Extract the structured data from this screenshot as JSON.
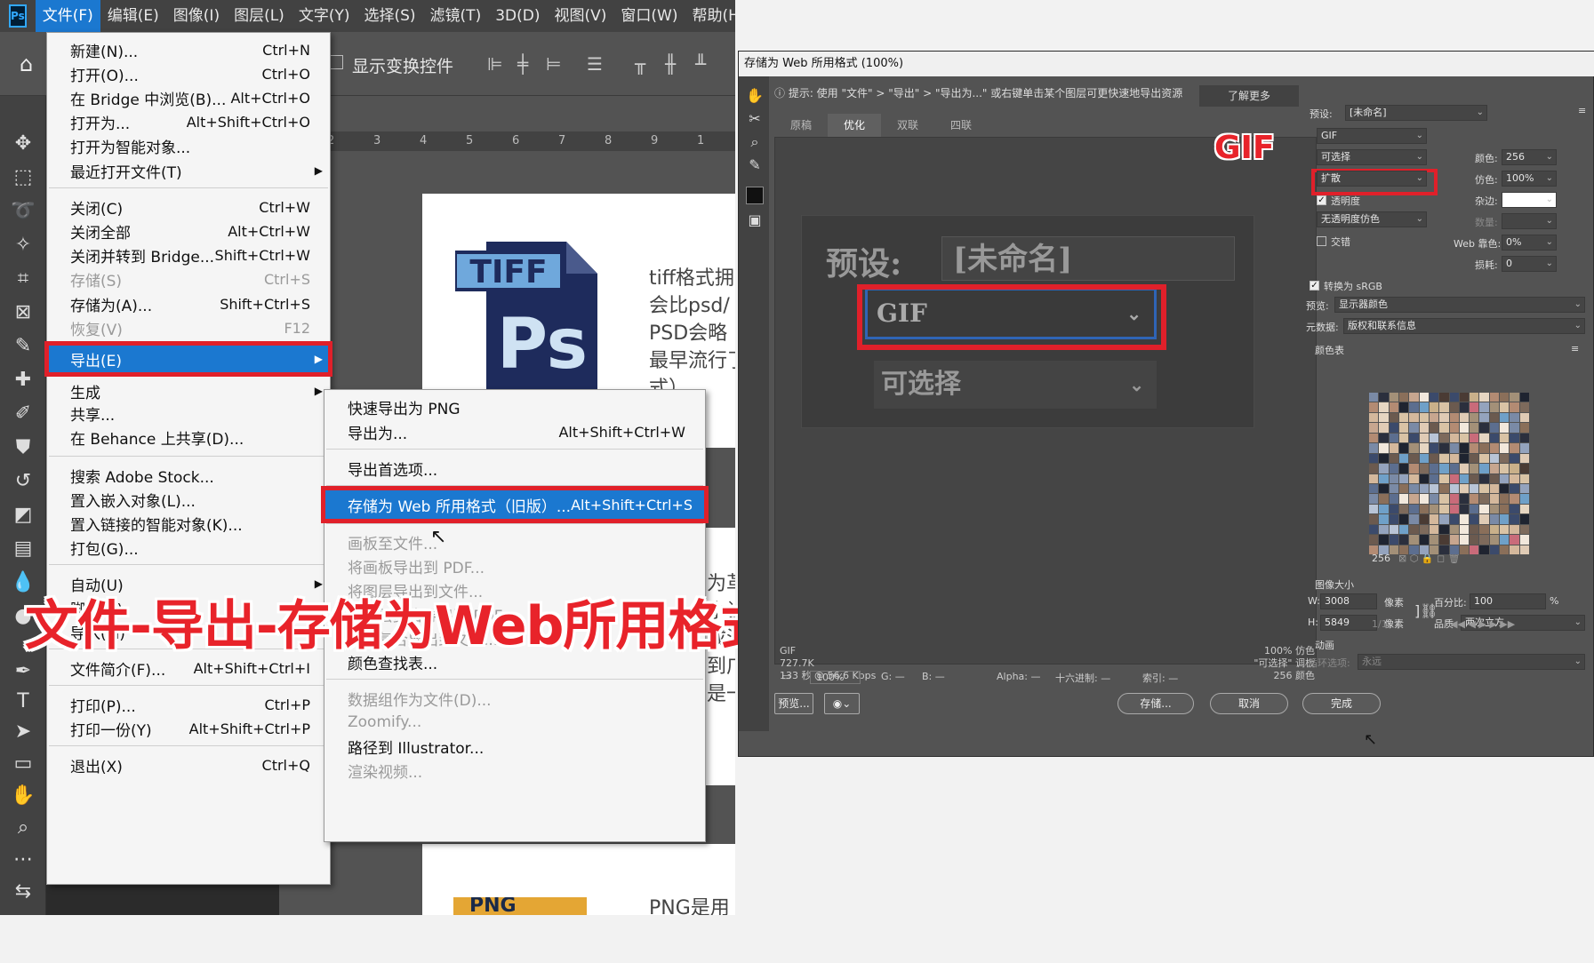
{
  "ps": {
    "logo": "Ps",
    "menubar": [
      "文件(F)",
      "编辑(E)",
      "图像(I)",
      "图层(L)",
      "文字(Y)",
      "选择(S)",
      "滤镜(T)",
      "3D(D)",
      "视图(V)",
      "窗口(W)",
      "帮助(H"
    ],
    "options": {
      "show_transform": "显示变换控件"
    },
    "ruler": [
      "1",
      "2",
      "3",
      "4",
      "5",
      "6",
      "7",
      "8",
      "9"
    ],
    "doc_text_1": [
      "tiff格式拥",
      "会比psd/",
      "PSD会略",
      "最早流行了",
      "式）。"
    ],
    "doc_text_2": [
      "为革",
      "小让",
      "成泊",
      "到广",
      "是一"
    ],
    "doc_text_3": "PNG是用",
    "tiff_icon_text": "TIFF",
    "tiff_icon_ps": "Ps",
    "png_icon_text": "PNG"
  },
  "file_menu": [
    {
      "label": "新建(N)...",
      "key": "Ctrl+N"
    },
    {
      "label": "打开(O)...",
      "key": "Ctrl+O"
    },
    {
      "label": "在 Bridge 中浏览(B)...",
      "key": "Alt+Ctrl+O"
    },
    {
      "label": "打开为...",
      "key": "Alt+Shift+Ctrl+O"
    },
    {
      "label": "打开为智能对象...",
      "key": ""
    },
    {
      "label": "最近打开文件(T)",
      "key": ""
    },
    {
      "label": "关闭(C)",
      "key": "Ctrl+W"
    },
    {
      "label": "关闭全部",
      "key": "Alt+Ctrl+W"
    },
    {
      "label": "关闭并转到 Bridge...",
      "key": "Shift+Ctrl+W"
    },
    {
      "label": "存储(S)",
      "key": "Ctrl+S"
    },
    {
      "label": "存储为(A)...",
      "key": "Shift+Ctrl+S"
    },
    {
      "label": "恢复(V)",
      "key": "F12"
    },
    {
      "label": "导出(E)",
      "key": ""
    },
    {
      "label": "生成",
      "key": ""
    },
    {
      "label": "共享...",
      "key": ""
    },
    {
      "label": "在 Behance 上共享(D)...",
      "key": ""
    },
    {
      "label": "搜索 Adobe Stock...",
      "key": ""
    },
    {
      "label": "置入嵌入对象(L)...",
      "key": ""
    },
    {
      "label": "置入链接的智能对象(K)...",
      "key": ""
    },
    {
      "label": "打包(G)...",
      "key": ""
    },
    {
      "label": "自动(U)",
      "key": ""
    },
    {
      "label": "脚本(R)",
      "key": ""
    },
    {
      "label": "导入(M)",
      "key": ""
    },
    {
      "label": "文件简介(F)...",
      "key": "Alt+Shift+Ctrl+I"
    },
    {
      "label": "打印(P)...",
      "key": "Ctrl+P"
    },
    {
      "label": "打印一份(Y)",
      "key": "Alt+Shift+Ctrl+P"
    },
    {
      "label": "退出(X)",
      "key": "Ctrl+Q"
    }
  ],
  "export_menu": [
    {
      "label": "快速导出为 PNG",
      "key": ""
    },
    {
      "label": "导出为...",
      "key": "Alt+Shift+Ctrl+W"
    },
    {
      "label": "导出首选项...",
      "key": ""
    },
    {
      "label": "存储为 Web 所用格式（旧版）...",
      "key": "Alt+Shift+Ctrl+S"
    },
    {
      "label": "画板至文件...",
      "key": ""
    },
    {
      "label": "将画板导出到 PDF...",
      "key": ""
    },
    {
      "label": "将图层导出到文件...",
      "key": ""
    },
    {
      "label": "将图层复合导出到 PDF...",
      "key": ""
    },
    {
      "label": "图层复合导出到文件...",
      "key": ""
    },
    {
      "label": "颜色查找表...",
      "key": ""
    },
    {
      "label": "数据组作为文件(D)...",
      "key": ""
    },
    {
      "label": "Zoomify...",
      "key": ""
    },
    {
      "label": "路径到 Illustrator...",
      "key": ""
    },
    {
      "label": "渲染视频...",
      "key": ""
    }
  ],
  "caption": "文件-导出-存储为Web所用格式（旧版）",
  "gif_caption": "GIF",
  "dialog": {
    "title": "存储为 Web 所用格式 (100%)",
    "hint": "提示: 使用 \"文件\" > \"导出\" > \"导出为...\" 或右键单击某个图层可更快速地导出资源",
    "learn_more": "了解更多",
    "tabs": [
      "原稿",
      "优化",
      "双联",
      "四联"
    ],
    "zoom_preset_label": "预设:",
    "zoom_preset_value": "[未命名]",
    "zoom_format": "GIF",
    "zoom_reduction": "可选择",
    "preview_info_left": [
      "GIF",
      "727.7K",
      "133 秒 @ 56.6 Kbps"
    ],
    "preview_info_right": [
      "100% 仿色",
      "\"可选择\" 调板",
      "256 颜色"
    ],
    "status": {
      "zoom": "100%",
      "r": "G: —",
      "b": "B: —",
      "alpha": "Alpha: —",
      "hex": "十六进制: —",
      "index": "索引: —"
    },
    "preview_button": "预览...",
    "save_button": "存储...",
    "cancel_button": "取消",
    "done_button": "完成",
    "settings": {
      "preset_label": "预设:",
      "preset_value": "[未命名]",
      "format": "GIF",
      "reduction": "可选择",
      "dither_algo": "扩散",
      "transparency": "透明度",
      "matte_dither": "无透明度仿色",
      "interlaced": "交错",
      "colors_label": "颜色:",
      "colors_value": "256",
      "dither_label": "仿色:",
      "dither_value": "100%",
      "matte_label": "杂边:",
      "amount_label": "数量:",
      "web_snap_label": "Web 靠色:",
      "web_snap_value": "0%",
      "lossy_label": "损耗:",
      "lossy_value": "0",
      "convert_srgb": "转换为 sRGB",
      "preview_label": "预览:",
      "preview_value": "显示器颜色",
      "metadata_label": "元数据:",
      "metadata_value": "版权和联系信息",
      "color_table": "颜色表",
      "color_count": "256",
      "image_size": "图像大小",
      "w_label": "W:",
      "w_value": "3008",
      "h_label": "H:",
      "h_value": "5849",
      "px": "像素",
      "percent_label": "百分比:",
      "percent_value": "100",
      "percent_unit": "%",
      "quality_label": "品质:",
      "quality_value": "两次立方",
      "animation": "动画",
      "loop_label": "循环选项:",
      "loop_value": "永远",
      "frame": "1/1"
    }
  },
  "colors": {
    "accent": "#1b78d0",
    "highlight_red": "#e0202a",
    "ps_dark": "#424242",
    "ps_mid": "#535353"
  }
}
